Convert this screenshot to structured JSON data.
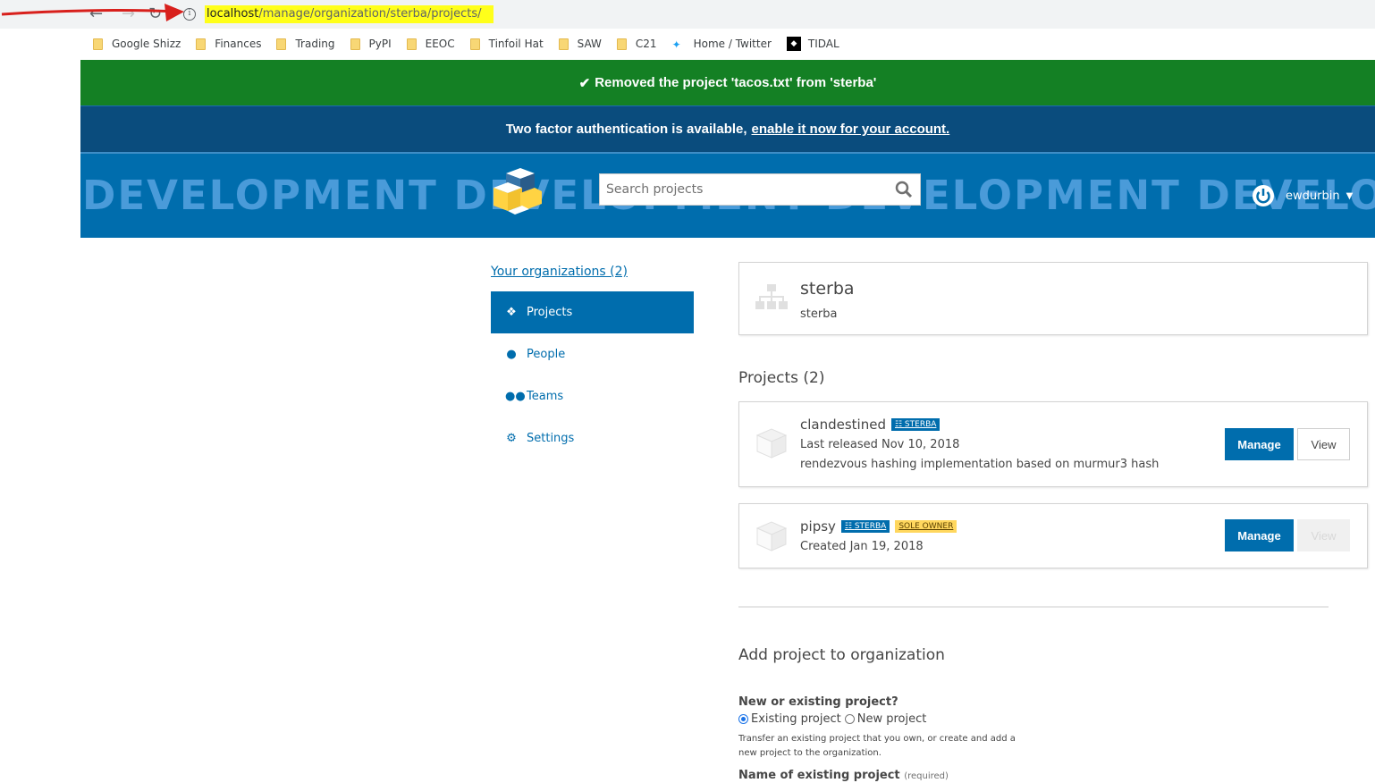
{
  "browser": {
    "url_host": "localhost",
    "url_path": "/manage/organization/sterba/projects/",
    "bookmarks": [
      "Google Shizz",
      "Finances",
      "Trading",
      "PyPI",
      "EEOC",
      "Tinfoil Hat",
      "SAW",
      "C21",
      "Home / Twitter",
      "TIDAL"
    ]
  },
  "flash": {
    "success": "Removed the project 'tacos.txt' from 'sterba'",
    "twofa_text": "Two factor authentication is available,",
    "twofa_link": "enable it now for your account."
  },
  "header": {
    "banner": "DEVELOPMENT DEVELOPMENT DEVELOPMENT DEVELOPMENT DEVELOPMENT",
    "search_placeholder": "Search projects",
    "username": "ewdurbin"
  },
  "sidebar": {
    "org_link": "Your organizations (2)",
    "items": [
      {
        "label": "Projects",
        "icon": "cube-icon",
        "active": true
      },
      {
        "label": "People",
        "icon": "user-icon",
        "active": false
      },
      {
        "label": "Teams",
        "icon": "users-icon",
        "active": false
      },
      {
        "label": "Settings",
        "icon": "wrench-icon",
        "active": false
      }
    ]
  },
  "org": {
    "name": "sterba",
    "display_name": "sterba"
  },
  "projects_title": "Projects (2)",
  "projects": [
    {
      "name": "clandestined",
      "org_badge": "STERBA",
      "line1": "Last released Nov 10, 2018",
      "line2": "rendezvous hashing implementation based on murmur3 hash",
      "manage": "Manage",
      "view": "View"
    },
    {
      "name": "pipsy",
      "org_badge": "STERBA",
      "owner_badge": "SOLE OWNER",
      "line1": "Created Jan 19, 2018",
      "manage": "Manage",
      "view": "View"
    }
  ],
  "add_form": {
    "title": "Add project to organization",
    "question": "New or existing project?",
    "option_existing": "Existing project",
    "option_new": "New project",
    "help": "Transfer an existing project that you own, or create and add a new project to the organization.",
    "name_label": "Name of existing project",
    "required": "(required)"
  },
  "colors": {
    "accent": "#006dad",
    "success": "#148024",
    "twofa": "#0a4c7d",
    "highlight": "#ffff1a"
  }
}
